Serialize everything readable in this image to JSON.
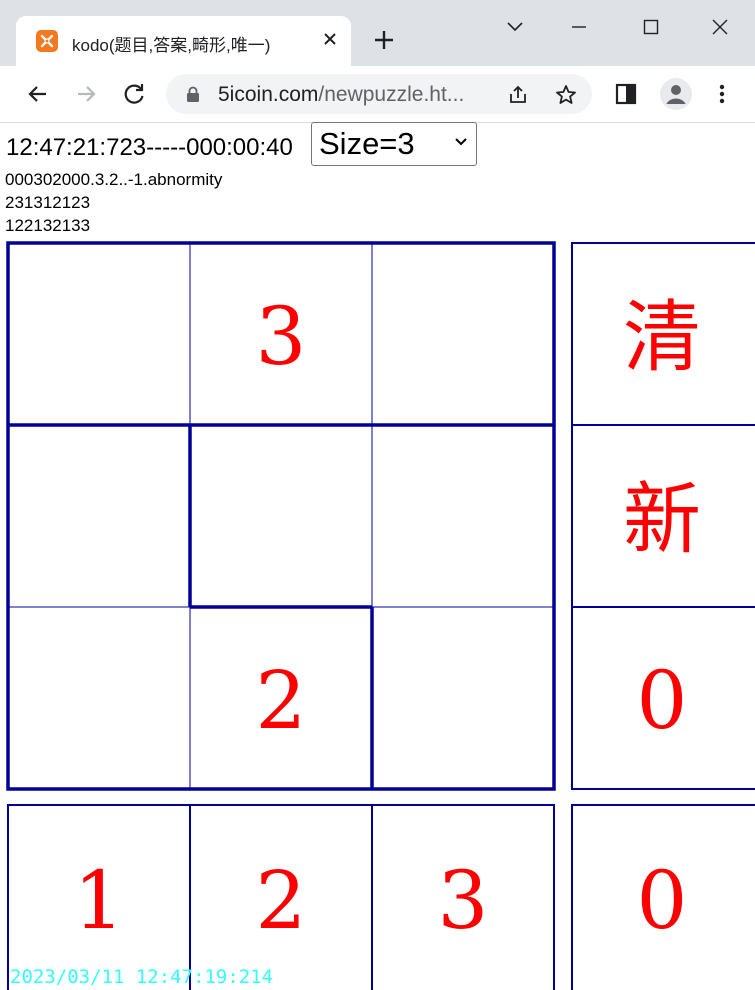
{
  "browser": {
    "tab_title": "kodo(题目,答案,畸形,唯一)",
    "url_host": "5icoin.com",
    "url_rest": "/newpuzzle.ht..."
  },
  "page": {
    "clock": "12:47:21:723-----000:00:40",
    "size_select": {
      "value": "Size=3"
    },
    "info_lines": [
      "000302000.3.2..-1.abnormity",
      "231312123",
      "122132133"
    ],
    "grid": [
      [
        "",
        "3",
        ""
      ],
      [
        "",
        "",
        ""
      ],
      [
        "",
        "2",
        ""
      ]
    ],
    "side_buttons": [
      "清",
      "新",
      "0"
    ],
    "bottom_row": [
      "1",
      "2",
      "3"
    ],
    "bottom_side": "0",
    "timestamp": "2023/03/11 12:47:19:214"
  },
  "colors": {
    "accent": "#000099",
    "digit": "#ff0000",
    "timestamp": "#33ffff"
  }
}
